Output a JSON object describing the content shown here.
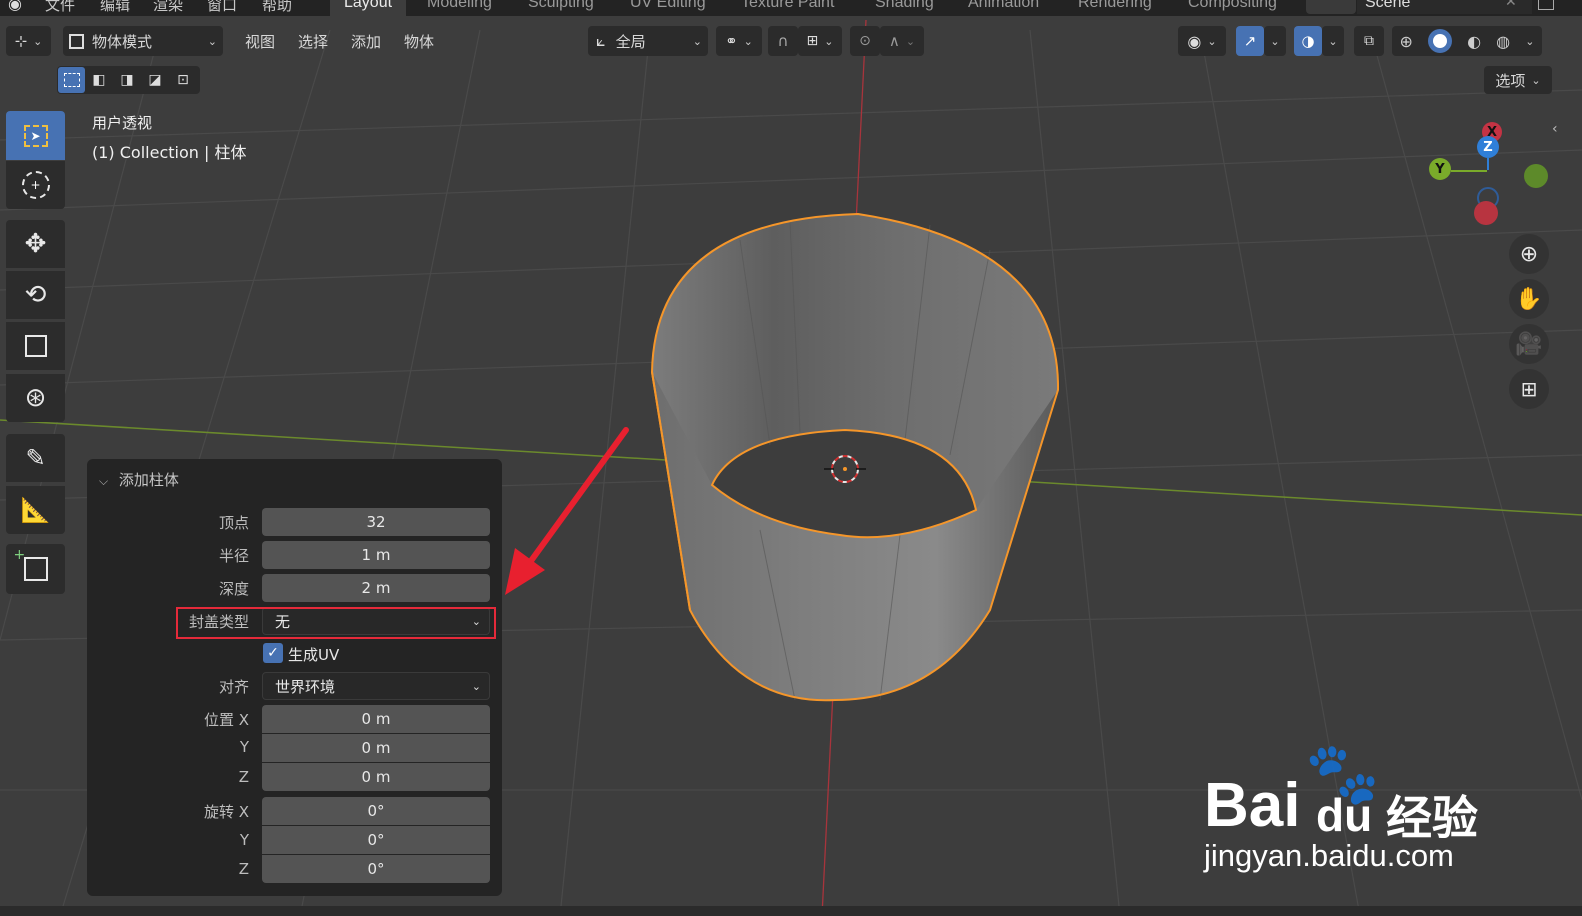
{
  "topbar": {
    "menus": [
      "文件",
      "编辑",
      "渲染",
      "窗口",
      "帮助"
    ],
    "workspaces": [
      "Layout",
      "Modeling",
      "Sculpting",
      "UV Editing",
      "Texture Paint",
      "Shading",
      "Animation",
      "Rendering",
      "Compositing"
    ],
    "active_workspace": "Layout",
    "scene": "Scene"
  },
  "header": {
    "mode": "物体模式",
    "menu": [
      "视图",
      "选择",
      "添加",
      "物体"
    ],
    "orientation": "全局",
    "options": "选项"
  },
  "overlay": {
    "view_name": "用户透视",
    "collection": "(1) Collection | 柱体"
  },
  "gizmo": {
    "x": "X",
    "y": "Y",
    "z": "Z"
  },
  "panel": {
    "title": "添加柱体",
    "vertices": {
      "label": "顶点",
      "value": "32"
    },
    "radius": {
      "label": "半径",
      "value": "1 m"
    },
    "depth": {
      "label": "深度",
      "value": "2 m"
    },
    "cap_type": {
      "label": "封盖类型",
      "value": "无"
    },
    "generate_uv": {
      "label": "生成UV",
      "checked": true
    },
    "align": {
      "label": "对齐",
      "value": "世界环境"
    },
    "location": {
      "label": "位置 X",
      "x": "0 m",
      "label_y": "Y",
      "y": "0 m",
      "label_z": "Z",
      "z": "0 m"
    },
    "rotation": {
      "label": "旋转 X",
      "x": "0°",
      "label_y": "Y",
      "y": "0°",
      "label_z": "Z",
      "z": "0°"
    }
  },
  "watermark": {
    "brand": "Bai",
    "brand2": "du",
    "cn": "经验",
    "url": "jingyan.baidu.com"
  },
  "colors": {
    "accent": "#4772b3",
    "selection": "#f5962a",
    "highlight_box": "#e52a3a",
    "arrow": "#e8202f"
  }
}
